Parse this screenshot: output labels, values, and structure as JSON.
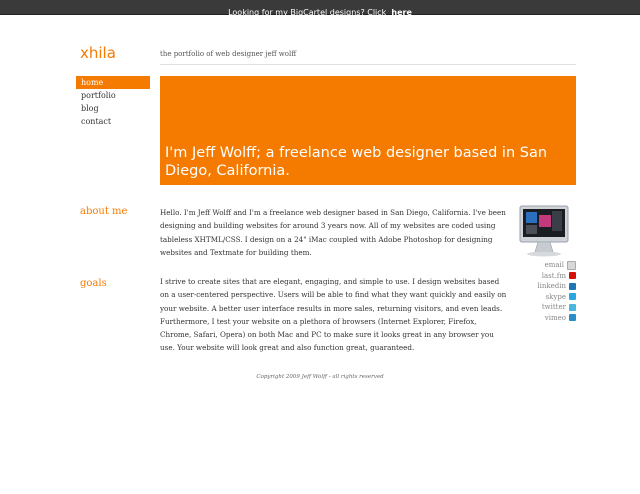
{
  "topbar": {
    "text": "Looking for my BigCartel designs? Click",
    "link": "here"
  },
  "site": {
    "logo": "xhila",
    "tagline": "the portfolio of web designer jeff wolff"
  },
  "nav": {
    "items": [
      {
        "label": "home",
        "active": true
      },
      {
        "label": "portfolio",
        "active": false
      },
      {
        "label": "blog",
        "active": false
      },
      {
        "label": "contact",
        "active": false
      }
    ]
  },
  "hero": {
    "text": "I'm Jeff Wolff; a freelance web designer based in San Diego, California."
  },
  "about": {
    "title": "about me",
    "text": "Hello. I'm Jeff Wolff and I'm a freelance web designer based in San Diego, California. I've been designing and building websites for around 3 years now. All of my websites are coded using tableless XHTML/CSS. I design on a 24\" iMac coupled with Adobe Photoshop for designing websites and Textmate for building them."
  },
  "goals": {
    "title": "goals",
    "text": "I strive to create sites that are elegant, engaging, and simple to use. I design websites based on a user-centered perspective. Users will be able to find what they want quickly and easily on your website. A better user interface results in more sales, returning visitors, and even leads. Furthermore, I test your website on a plethora of browsers (Internet Explorer, Firefox, Chrome, Safari, Opera) on both Mac and PC to make sure it looks great in any browser you use. Your website will look great and also function great, guaranteed."
  },
  "social": [
    {
      "label": "email",
      "icon": "email-icon",
      "color": "#d8d8d8"
    },
    {
      "label": "last.fm",
      "icon": "lastfm-icon",
      "color": "#d51007"
    },
    {
      "label": "linkedin",
      "icon": "linkedin-icon",
      "color": "#1f76b3"
    },
    {
      "label": "skype",
      "icon": "skype-icon",
      "color": "#2aa6e0"
    },
    {
      "label": "twitter",
      "icon": "twitter-icon",
      "color": "#4ab6de"
    },
    {
      "label": "vimeo",
      "icon": "vimeo-icon",
      "color": "#2a8fc9"
    }
  ],
  "footer": {
    "text": "Copyright 2009 Jeff Wolff - all rights reserved"
  },
  "colors": {
    "accent": "#f57a00",
    "topbar": "#3a3a3a"
  }
}
